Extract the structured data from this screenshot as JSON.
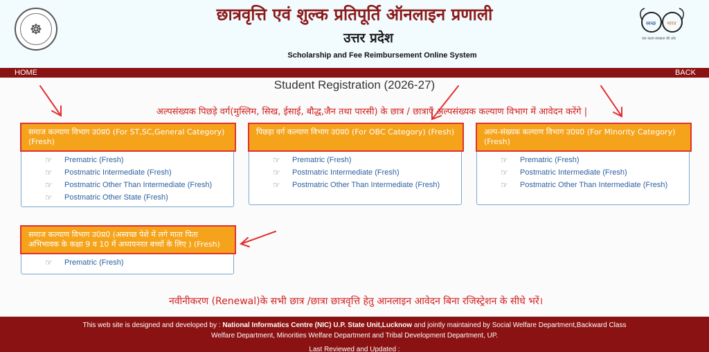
{
  "header": {
    "title_hi": "छात्रवृत्ति एवं शुल्क प्रतिपूर्ति ऑनलाइन प्रणाली",
    "subtitle_hi": "उत्तर प्रदेश",
    "subtitle_en": "Scholarship and Fee Reimbursement Online System",
    "logo_left_icon": "up-govt-emblem-icon",
    "logo_right_icon": "swachh-bharat-glasses-icon",
    "logo_right_text": "स्वच्छ भारत",
    "logo_right_tagline": "एक कदम स्वच्छता की ओर"
  },
  "nav": {
    "home": "HOME",
    "back": "BACK"
  },
  "page": {
    "reg_title": "Student Registration (2026-27)",
    "notice_minority": "अल्पसंख्यक पिछड़े वर्ग(मुस्लिम, सिख, ईसाई, बौद्ध,जैन तथा पारसी) के छात्र / छात्राएँ अल्पसंख्यक कल्याण विभाग में आवेदन करेंगे |",
    "notice_renewal": "नवीनीकरण (Renewal)के सभी छात्र /छात्रा छात्रवृत्ति हेतु आनलाइन आवेदन बिना रजिस्ट्रेशन के सीधे भरें।"
  },
  "panels": [
    {
      "title": "समाज कल्याण विभाग उ0प्र0 (For ST,SC,General Category) (Fresh)",
      "items": [
        "Prematric (Fresh)",
        "Postmatric Intermediate (Fresh)",
        "Postmatric Other Than Intermediate (Fresh)",
        "Postmatric Other State (Fresh)"
      ]
    },
    {
      "title": "पिछड़ा वर्ग कल्याण विभाग उ0प्र0 (For OBC Category) (Fresh)",
      "items": [
        "Prematric (Fresh)",
        "Postmatric Intermediate (Fresh)",
        "Postmatric Other Than Intermediate (Fresh)"
      ]
    },
    {
      "title": "अल्प-संख्यक कल्याण विभाग उ0प्र0 (For Minority Category) (Fresh)",
      "items": [
        "Prematric (Fresh)",
        "Postmatric Intermediate (Fresh)",
        "Postmatric Other Than Intermediate (Fresh)"
      ]
    },
    {
      "title": "समाज कल्याण विभाग उ0प्र0 (अस्वच्छ पेशे में लगे माता पिता अभिभावक के कक्षा 9 व 10 में अध्ययनरत बच्चों के लिए ) (Fresh)",
      "items": [
        "Prematric (Fresh)"
      ]
    }
  ],
  "footer": {
    "line1_pre": "This web site is designed and developed by : ",
    "line1_bold": "National Informatics Centre (NIC) U.P. State Unit,Lucknow",
    "line1_post": " and jointly maintained by Social Welfare Department,Backward Class",
    "line2": "Welfare Department, Minorities Welfare Department and Tribal Development Department, UP.",
    "line3": "Last Reviewed and Updated :"
  },
  "colors": {
    "header_bg": "#f2fbfe",
    "nav_bg": "#8b1212",
    "panel_head": "#f5a31a",
    "highlight": "#e03030",
    "link": "#2c5fa0",
    "notice": "#d32020"
  }
}
